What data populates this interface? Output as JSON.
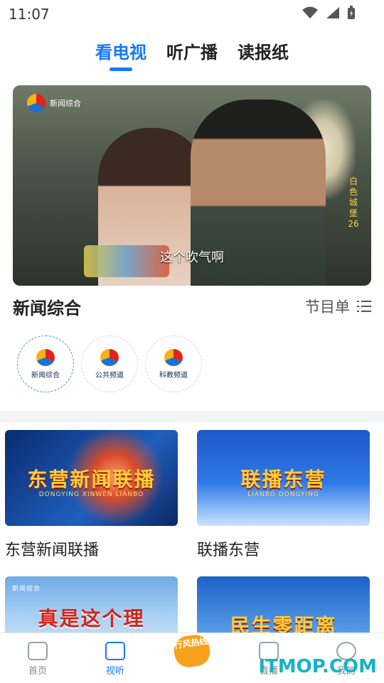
{
  "status_bar": {
    "time": "11:07"
  },
  "tabs": [
    {
      "label": "看电视",
      "active": true
    },
    {
      "label": "听广播",
      "active": false
    },
    {
      "label": "读报纸",
      "active": false
    }
  ],
  "player": {
    "channel_logo_text": "新闻综合",
    "subtitle": "这个吹气啊",
    "side_caption": "白色城堡26"
  },
  "channel_section": {
    "title": "新闻综合",
    "schedule_label": "节目单",
    "channels": [
      {
        "label": "新闻综合",
        "active": true
      },
      {
        "label": "公共频道",
        "active": false
      },
      {
        "label": "科教频道",
        "active": false
      }
    ]
  },
  "programs": [
    {
      "title": "东营新闻联播",
      "thumb_text": "东营新闻联播",
      "thumb_sub": "DONGYING XINWEN LIANBO"
    },
    {
      "title": "联播东营",
      "thumb_text": "联播东营",
      "thumb_sub": "LIANBO DONGYING"
    },
    {
      "title": "",
      "thumb_text": "真是这个理",
      "thumb_sub": "新闻综合"
    },
    {
      "title": "",
      "thumb_text": "民生零距离",
      "thumb_sub": ""
    }
  ],
  "bottom_nav": [
    {
      "label": "首页",
      "icon": "home-icon",
      "active": false
    },
    {
      "label": "视听",
      "icon": "video-icon",
      "active": true
    },
    {
      "label": "行风热线",
      "icon": "hotline-badge",
      "active": false
    },
    {
      "label": "直播",
      "icon": "tv-icon",
      "active": false
    },
    {
      "label": "我的",
      "icon": "user-icon",
      "active": false
    }
  ],
  "watermark": "ITMOP.COM",
  "colors": {
    "accent": "#1677ff",
    "hotline": "#f6a21b"
  }
}
